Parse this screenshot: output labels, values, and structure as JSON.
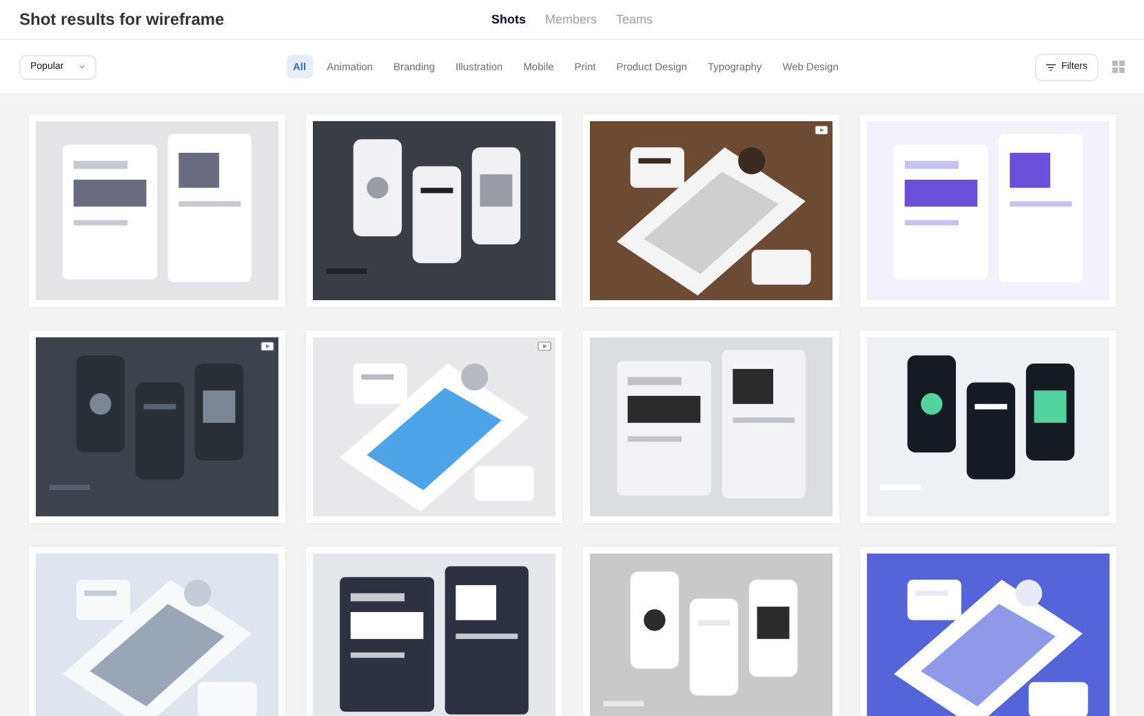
{
  "header": {
    "title": "Shot results for wireframe",
    "tabs": [
      {
        "label": "Shots",
        "selected": true
      },
      {
        "label": "Members",
        "selected": false
      },
      {
        "label": "Teams",
        "selected": false
      }
    ]
  },
  "filter_bar": {
    "sort": "Popular",
    "categories": [
      {
        "label": "All",
        "selected": true
      },
      {
        "label": "Animation",
        "selected": false
      },
      {
        "label": "Branding",
        "selected": false
      },
      {
        "label": "Illustration",
        "selected": false
      },
      {
        "label": "Mobile",
        "selected": false
      },
      {
        "label": "Print",
        "selected": false
      },
      {
        "label": "Product Design",
        "selected": false
      },
      {
        "label": "Typography",
        "selected": false
      },
      {
        "label": "Web Design",
        "selected": false
      }
    ],
    "filters_button": "Filters"
  },
  "shots": [
    {
      "kind": "picture",
      "badge": false
    },
    {
      "kind": "picture",
      "badge": false
    },
    {
      "kind": "picture",
      "badge": true
    },
    {
      "kind": "picture",
      "badge": false
    },
    {
      "kind": "picture",
      "badge": true
    },
    {
      "kind": "picture",
      "badge": true
    },
    {
      "kind": "picture",
      "badge": false
    },
    {
      "kind": "picture",
      "badge": false
    },
    {
      "kind": "picture",
      "badge": false
    },
    {
      "kind": "picture",
      "badge": false
    },
    {
      "kind": "picture",
      "badge": false
    },
    {
      "kind": "picture",
      "badge": false
    }
  ]
}
